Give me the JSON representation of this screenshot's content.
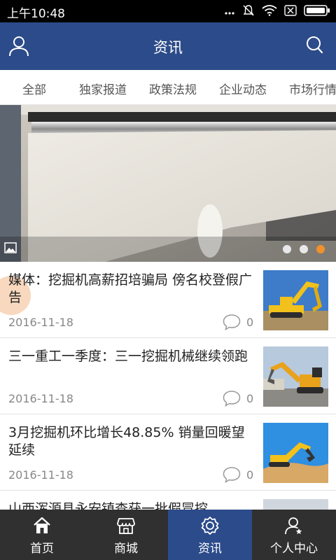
{
  "status_bar": {
    "time": "上午10:48"
  },
  "header": {
    "title": "资讯"
  },
  "tabs": [
    "全部",
    "独家报道",
    "政策法规",
    "企业动态",
    "市场行情"
  ],
  "banner": {
    "slide_count": 3,
    "active_slide": 3
  },
  "news": [
    {
      "title": "媒体：挖掘机高薪招培骗局 傍名校登假广告",
      "date": "2016-11-18",
      "comments": "0"
    },
    {
      "title": "三一重工一季度：三一挖掘机械继续领跑",
      "date": "2016-11-18",
      "comments": "0"
    },
    {
      "title": "3月挖掘机环比增长48.85% 销量回暖望延续",
      "date": "2016-11-18",
      "comments": "0"
    },
    {
      "title": "山西浑源县永安镇查获一批假冒挖",
      "date": "",
      "comments": ""
    }
  ],
  "bottom_nav": [
    {
      "label": "首页",
      "icon": "home-icon"
    },
    {
      "label": "商城",
      "icon": "store-icon"
    },
    {
      "label": "资讯",
      "icon": "news-icon"
    },
    {
      "label": "个人中心",
      "icon": "user-center-icon"
    }
  ],
  "colors": {
    "header": "#2c4b8a",
    "active_dot": "#f0912b",
    "bottom_nav": "#303030"
  }
}
